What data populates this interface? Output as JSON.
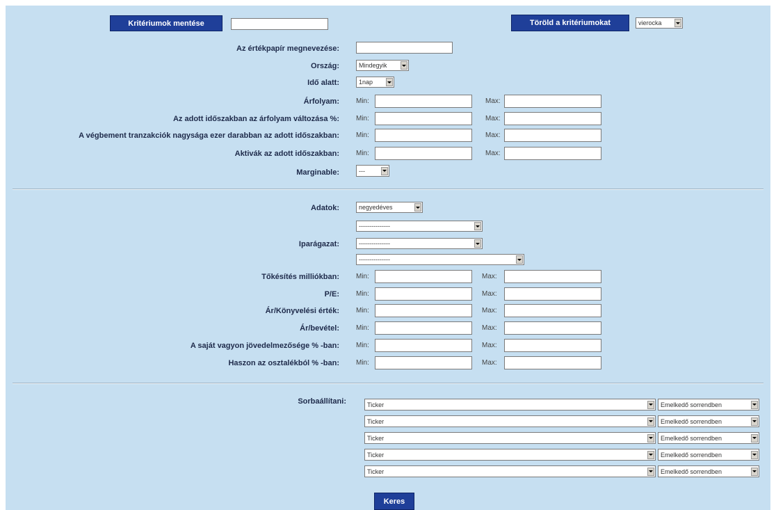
{
  "top": {
    "save_label": "Kritériumok mentése",
    "save_name_value": "",
    "delete_label": "Töröld a kritériumokat",
    "saved_select": "vierocka"
  },
  "filters1": {
    "name_label": "Az értékpapír megnevezése:",
    "country_label": "Ország:",
    "country_value": "Mindegyik",
    "period_label": "Idő alatt:",
    "period_value": "1nap",
    "rows": [
      {
        "label": "Árfolyam:"
      },
      {
        "label": "Az adott időszakban az árfolyam változása %:"
      },
      {
        "label": "A végbement tranzakciók nagysága ezer darabban az adott időszakban:"
      },
      {
        "label": "Aktivák az adott időszakban:"
      }
    ],
    "marginable_label": "Marginable:",
    "marginable_value": "---"
  },
  "minmax": {
    "min": "Min:",
    "max": "Max:"
  },
  "filters2": {
    "data_label": "Adatok:",
    "data_value": "negyedéves",
    "industry_label": "Iparágazat:",
    "industry_values": [
      "---------------",
      "---------------",
      "---------------"
    ],
    "rows": [
      {
        "label": "Tőkésítés milliókban:"
      },
      {
        "label": "P/E:"
      },
      {
        "label": "Ár/Könyvelési érték:"
      },
      {
        "label": "Ár/bevétel:"
      },
      {
        "label": "A saját vagyon jövedelmezősége % -ban:"
      },
      {
        "label": "Haszon az osztalékból % -ban:"
      }
    ]
  },
  "sort": {
    "label": "Sorbaállítani:",
    "rows": [
      {
        "field": "Ticker",
        "order": "Emelkedő sorrendben"
      },
      {
        "field": "Ticker",
        "order": "Emelkedő sorrendben"
      },
      {
        "field": "Ticker",
        "order": "Emelkedő sorrendben"
      },
      {
        "field": "Ticker",
        "order": "Emelkedő sorrendben"
      },
      {
        "field": "Ticker",
        "order": "Emelkedő sorrendben"
      }
    ]
  },
  "search_label": "Keres",
  "colors": {
    "panel": "#c6dff1",
    "button": "#1f3f99",
    "label": "#1e2a4a"
  }
}
